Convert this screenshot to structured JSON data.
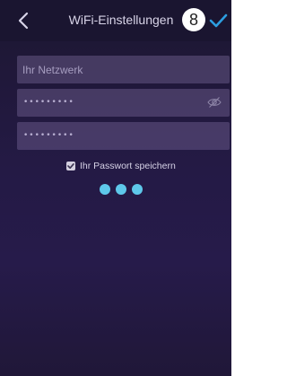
{
  "header": {
    "title": "WiFi-Einstellungen",
    "step_number": "8",
    "back_icon": "chevron-left-icon",
    "confirm_icon": "checkmark-icon"
  },
  "form": {
    "network_placeholder": "Ihr Netzwerk",
    "password_value": "•••••••••",
    "password_confirm_value": "•••••••••",
    "save_password_label": "Ihr Passwort speichern",
    "save_password_checked": true
  },
  "colors": {
    "accent": "#2d9ee0",
    "loader": "#5ec8ea",
    "background": "#241a45"
  }
}
